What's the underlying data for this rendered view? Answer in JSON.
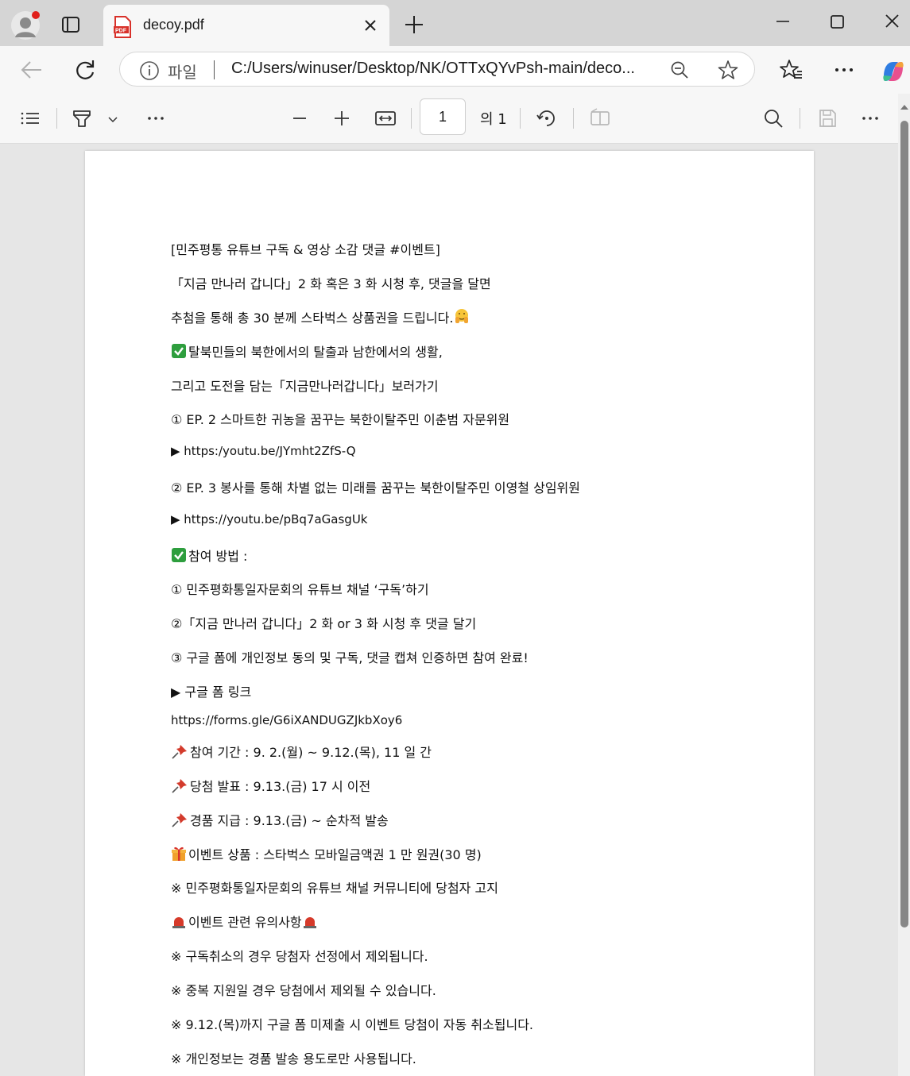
{
  "browser": {
    "tab_title": "decoy.pdf",
    "url_label": "파일",
    "url": "C:/Users/winuser/Desktop/NK/OTTxQYvPsh-main/deco..."
  },
  "pdf_toolbar": {
    "page_number": "1",
    "page_of": "의 1"
  },
  "document": {
    "lines": [
      "[민주평통 유튜브 구독 & 영상 소감 댓글 #이벤트]",
      "「지금 만나러 갑니다」2 화 혹은 3 화 시청 후, 댓글을 달면",
      "추첨을 통해 총 30 분께 스타벅스 상품권을 드립니다.",
      "탈북민들의 북한에서의 탈출과 남한에서의 생활,",
      "그리고 도전을 담는「지금만나러갑니다」보러가기",
      "① EP. 2 스마트한 귀농을 꿈꾸는 북한이탈주민 이춘범 자문위원",
      "▶ https:/youtu.be/JYmht2ZfS-Q",
      "② EP. 3 봉사를 통해 차별 없는 미래를 꿈꾸는 북한이탈주민 이영철 상임위원",
      "▶ https://youtu.be/pBq7aGasgUk",
      "참여 방법 :",
      "① 민주평화통일자문회의 유튜브 채널 ‘구독’하기",
      "②「지금 만나러 갑니다」2 화 or 3 화 시청 후 댓글 달기",
      "③ 구글 폼에 개인정보 동의 및 구독, 댓글 캡쳐 인증하면 참여 완료!",
      "▶ 구글 폼 링크",
      "https://forms.gle/G6iXANDUGZJkbXoy6",
      "참여 기간 : 9. 2.(월) ~ 9.12.(목), 11 일 간",
      "당첨 발표 : 9.13.(금) 17 시 이전",
      "경품 지급 : 9.13.(금) ~ 순차적 발송",
      "이벤트 상품 : 스타벅스 모바일금액권 1 만 원권(30 명)",
      "※ 민주평화통일자문회의 유튜브 채널 커뮤니티에 당첨자 고지",
      "이벤트 관련 유의사항",
      "※ 구독취소의 경우 당첨자 선정에서 제외됩니다.",
      "※ 중복 지원일 경우 당첨에서 제외될 수 있습니다.",
      "※ 9.12.(목)까지 구글 폼 미제출 시 이벤트 당첨이 자동 취소됩니다.",
      "※ 개인정보는 경품 발송 용도로만 사용됩니다."
    ]
  },
  "icons": {
    "profile": "profile-icon",
    "tab_actions": "tab-actions-icon",
    "pdf": "pdf-file-icon",
    "close": "close-icon",
    "new_tab": "plus-icon",
    "minimize": "minimize-icon",
    "maximize": "maximize-icon",
    "back": "back-arrow-icon",
    "refresh": "refresh-icon",
    "info": "info-icon",
    "zoom": "zoom-icon",
    "favorite": "star-icon",
    "favorites": "favorites-icon",
    "more": "more-icon",
    "copilot": "copilot-icon",
    "contents": "table-of-contents-icon",
    "draw": "highlighter-icon",
    "chevron": "chevron-down-icon",
    "zoom_out": "minus-icon",
    "zoom_in": "plus-icon",
    "fit": "fit-width-icon",
    "rotate": "rotate-icon",
    "two_page": "page-view-icon",
    "search": "search-icon",
    "save": "save-icon",
    "emoji_hug": "hugging-face-emoji",
    "emoji_check": "check-mark-emoji",
    "emoji_pin": "pushpin-emoji",
    "emoji_gift": "gift-emoji",
    "emoji_siren": "siren-emoji"
  },
  "colors": {
    "tab_strip": "#d5d5d5",
    "toolbar": "#f7f7f7",
    "check_green": "#2e9e3e",
    "pin_red": "#d33b2c",
    "siren_red": "#d63a2a"
  }
}
